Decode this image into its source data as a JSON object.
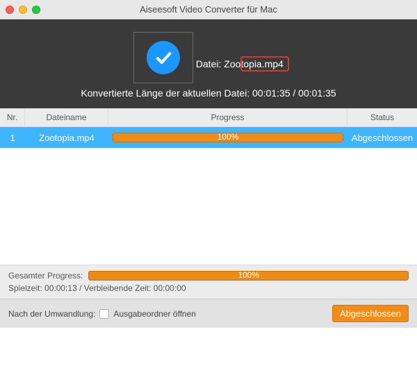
{
  "window": {
    "title": "Aiseesoft Video Converter für Mac"
  },
  "hero": {
    "file_prefix": "Datei: ",
    "filename": "Zootopia.mp4",
    "converted_line": "Konvertierte Länge der aktuellen Datei: 00:01:35 / 00:01:35"
  },
  "table": {
    "headers": {
      "nr": "Nr.",
      "name": "Dateiname",
      "progress": "Progress",
      "status": "Status"
    },
    "rows": [
      {
        "nr": "1",
        "name": "Zootopia.mp4",
        "percent": "100%",
        "status": "Abgeschlossen"
      }
    ]
  },
  "overall": {
    "label": "Gesamter Progress:",
    "percent": "100%",
    "timeline": "Spielzeit: 00:00:13 / Verbleibende Zeit: 00:00:00"
  },
  "footer": {
    "after_label": "Nach der Umwandlung:",
    "open_folder": "Ausgabeordner öffnen",
    "done_btn": "Abgeschlossen"
  }
}
